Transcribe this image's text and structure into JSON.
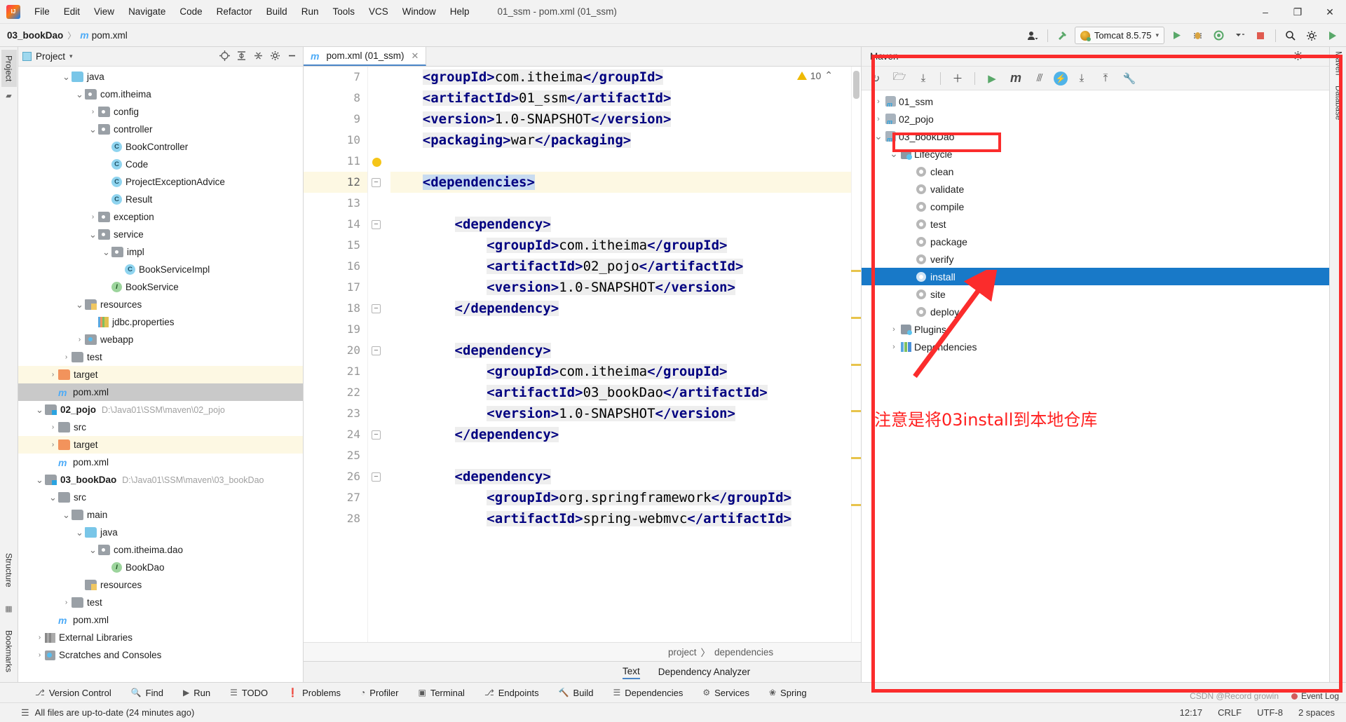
{
  "titlebar": {
    "menus": [
      "File",
      "Edit",
      "View",
      "Navigate",
      "Code",
      "Refactor",
      "Build",
      "Run",
      "Tools",
      "VCS",
      "Window",
      "Help"
    ],
    "window_title": "01_ssm - pom.xml (01_ssm)",
    "minimize": "–",
    "maximize": "❐",
    "close": "✕",
    "logo_name": "intellij-idea-logo"
  },
  "toolbar": {
    "breadcrumb_project": "03_bookDao",
    "breadcrumb_sep": "〉",
    "breadcrumb_file": "pom.xml",
    "m_glyph": "m",
    "run_config": "Tomcat 8.5.75",
    "run_config_caret": "▾",
    "icons": {
      "user": "♟",
      "hammer": "⚒",
      "run": "▶",
      "debug": "🐞",
      "coverage": "⬤",
      "more": "▾",
      "stop": "■",
      "search": "🔍",
      "settings": "⚙",
      "updates": "▶"
    }
  },
  "left_rail": {
    "project_tab": "Project",
    "structure_tab": "Structure",
    "bookmarks_tab": "Bookmarks"
  },
  "project_panel": {
    "title": "Project",
    "caret": "▾",
    "header_icons": [
      "locate-icon",
      "expand-all-icon",
      "collapse-all-icon",
      "settings-icon",
      "hide-icon"
    ],
    "tree": [
      {
        "indent": 3,
        "arrow": "v",
        "icon": "folder-blue",
        "label": "java"
      },
      {
        "indent": 4,
        "arrow": "v",
        "icon": "folder-pkg",
        "label": "com.itheima"
      },
      {
        "indent": 5,
        "arrow": ">",
        "icon": "folder-pkg",
        "label": "config"
      },
      {
        "indent": 5,
        "arrow": "v",
        "icon": "folder-pkg",
        "label": "controller"
      },
      {
        "indent": 6,
        "arrow": "",
        "icon": "class",
        "label": "BookController"
      },
      {
        "indent": 6,
        "arrow": "",
        "icon": "class",
        "label": "Code"
      },
      {
        "indent": 6,
        "arrow": "",
        "icon": "class",
        "label": "ProjectExceptionAdvice"
      },
      {
        "indent": 6,
        "arrow": "",
        "icon": "class",
        "label": "Result"
      },
      {
        "indent": 5,
        "arrow": ">",
        "icon": "folder-pkg",
        "label": "exception"
      },
      {
        "indent": 5,
        "arrow": "v",
        "icon": "folder-pkg",
        "label": "service"
      },
      {
        "indent": 6,
        "arrow": "v",
        "icon": "folder-pkg",
        "label": "impl"
      },
      {
        "indent": 7,
        "arrow": "",
        "icon": "class",
        "label": "BookServiceImpl"
      },
      {
        "indent": 6,
        "arrow": "",
        "icon": "interface",
        "label": "BookService"
      },
      {
        "indent": 4,
        "arrow": "v",
        "icon": "folder-res",
        "label": "resources"
      },
      {
        "indent": 5,
        "arrow": "",
        "icon": "properties",
        "label": "jdbc.properties"
      },
      {
        "indent": 4,
        "arrow": ">",
        "icon": "folder-web",
        "label": "webapp"
      },
      {
        "indent": 3,
        "arrow": ">",
        "icon": "folder-gray",
        "label": "test"
      },
      {
        "indent": 2,
        "arrow": ">",
        "icon": "folder-orange",
        "label": "target",
        "highlight": "yellow"
      },
      {
        "indent": 2,
        "arrow": "",
        "icon": "maven-file",
        "label": "pom.xml",
        "highlight": "gray"
      },
      {
        "indent": 1,
        "arrow": "v",
        "icon": "folder-module",
        "label": "02_pojo",
        "bold": true,
        "path": "D:\\Java01\\SSM\\maven\\02_pojo"
      },
      {
        "indent": 2,
        "arrow": ">",
        "icon": "folder-gray",
        "label": "src"
      },
      {
        "indent": 2,
        "arrow": ">",
        "icon": "folder-orange",
        "label": "target",
        "highlight": "yellow"
      },
      {
        "indent": 2,
        "arrow": "",
        "icon": "maven-file",
        "label": "pom.xml"
      },
      {
        "indent": 1,
        "arrow": "v",
        "icon": "folder-module",
        "label": "03_bookDao",
        "bold": true,
        "path": "D:\\Java01\\SSM\\maven\\03_bookDao"
      },
      {
        "indent": 2,
        "arrow": "v",
        "icon": "folder-gray",
        "label": "src"
      },
      {
        "indent": 3,
        "arrow": "v",
        "icon": "folder-gray",
        "label": "main"
      },
      {
        "indent": 4,
        "arrow": "v",
        "icon": "folder-blue",
        "label": "java"
      },
      {
        "indent": 5,
        "arrow": "v",
        "icon": "folder-pkg",
        "label": "com.itheima.dao"
      },
      {
        "indent": 6,
        "arrow": "",
        "icon": "interface",
        "label": "BookDao"
      },
      {
        "indent": 4,
        "arrow": "",
        "icon": "folder-res",
        "label": "resources"
      },
      {
        "indent": 3,
        "arrow": ">",
        "icon": "folder-gray",
        "label": "test"
      },
      {
        "indent": 2,
        "arrow": "",
        "icon": "maven-file",
        "label": "pom.xml"
      },
      {
        "indent": 1,
        "arrow": ">",
        "icon": "external-libs",
        "label": "External Libraries"
      },
      {
        "indent": 1,
        "arrow": ">",
        "icon": "scratches",
        "label": "Scratches and Consoles"
      }
    ]
  },
  "editor": {
    "tab_label": "pom.xml (01_ssm)",
    "tab_m_glyph": "m",
    "tab_close": "✕",
    "warning_count": "10",
    "warning_collapse": "⌃",
    "lines": [
      {
        "no": "7",
        "text": "    <groupId>com.itheima</groupId>"
      },
      {
        "no": "8",
        "text": "    <artifactId>01_ssm</artifactId>"
      },
      {
        "no": "9",
        "text": "    <version>1.0-SNAPSHOT</version>"
      },
      {
        "no": "10",
        "text": "    <packaging>war</packaging>"
      },
      {
        "no": "11",
        "text": ""
      },
      {
        "no": "12",
        "text": "    <dependencies>",
        "selected": true,
        "fold": true,
        "bulb": true
      },
      {
        "no": "13",
        "text": ""
      },
      {
        "no": "14",
        "text": "        <dependency>",
        "fold": true
      },
      {
        "no": "15",
        "text": "            <groupId>com.itheima</groupId>"
      },
      {
        "no": "16",
        "text": "            <artifactId>02_pojo</artifactId>"
      },
      {
        "no": "17",
        "text": "            <version>1.0-SNAPSHOT</version>"
      },
      {
        "no": "18",
        "text": "        </dependency>",
        "fold": true
      },
      {
        "no": "19",
        "text": ""
      },
      {
        "no": "20",
        "text": "        <dependency>",
        "fold": true
      },
      {
        "no": "21",
        "text": "            <groupId>com.itheima</groupId>"
      },
      {
        "no": "22",
        "text": "            <artifactId>03_bookDao</artifactId>"
      },
      {
        "no": "23",
        "text": "            <version>1.0-SNAPSHOT</version>"
      },
      {
        "no": "24",
        "text": "        </dependency>",
        "fold": true
      },
      {
        "no": "25",
        "text": ""
      },
      {
        "no": "26",
        "text": "        <dependency>",
        "fold": true
      },
      {
        "no": "27",
        "text": "            <groupId>org.springframework</groupId>"
      },
      {
        "no": "28",
        "text": "            <artifactId>spring-webmvc</artifactId>"
      }
    ],
    "breadcrumb": [
      "project",
      "dependencies"
    ],
    "breadcrumb_sep": "〉",
    "bottom_tabs": [
      {
        "label": "Text",
        "active": true
      },
      {
        "label": "Dependency Analyzer",
        "active": false
      }
    ]
  },
  "maven": {
    "title": "Maven",
    "header_icons": [
      "settings-icon",
      "minimize-icon"
    ],
    "toolbar_icons": [
      {
        "name": "reload-all-maven-projects-icon",
        "glyph": "↻"
      },
      {
        "name": "generate-sources-icon",
        "glyph": "🗁"
      },
      {
        "name": "download-sources-icon",
        "glyph": "⤓"
      },
      {
        "name": "add-maven-project-icon",
        "glyph": "＋"
      },
      {
        "name": "run-maven-build-icon",
        "glyph": "▶"
      },
      {
        "name": "execute-maven-goal-icon",
        "glyph": "m"
      },
      {
        "name": "toggle-skip-tests-icon",
        "glyph": "⫻"
      },
      {
        "name": "toggle-offline-mode-icon",
        "glyph": "⚡"
      },
      {
        "name": "expand-all-icon",
        "glyph": "⤓"
      },
      {
        "name": "collapse-all-icon",
        "glyph": "⤒"
      },
      {
        "name": "maven-settings-icon",
        "glyph": "🔧"
      }
    ],
    "tree": [
      {
        "indent": 0,
        "arrow": ">",
        "icon": "maven-module",
        "label": "01_ssm"
      },
      {
        "indent": 0,
        "arrow": ">",
        "icon": "maven-module",
        "label": "02_pojo"
      },
      {
        "indent": 0,
        "arrow": "v",
        "icon": "maven-module",
        "label": "03_bookDao",
        "boxed": true
      },
      {
        "indent": 1,
        "arrow": "v",
        "icon": "lifecycle",
        "label": "Lifecycle"
      },
      {
        "indent": 2,
        "arrow": "",
        "icon": "goal",
        "label": "clean"
      },
      {
        "indent": 2,
        "arrow": "",
        "icon": "goal",
        "label": "validate"
      },
      {
        "indent": 2,
        "arrow": "",
        "icon": "goal",
        "label": "compile"
      },
      {
        "indent": 2,
        "arrow": "",
        "icon": "goal",
        "label": "test"
      },
      {
        "indent": 2,
        "arrow": "",
        "icon": "goal",
        "label": "package"
      },
      {
        "indent": 2,
        "arrow": "",
        "icon": "goal",
        "label": "verify"
      },
      {
        "indent": 2,
        "arrow": "",
        "icon": "goal",
        "label": "install",
        "selected": true
      },
      {
        "indent": 2,
        "arrow": "",
        "icon": "goal",
        "label": "site"
      },
      {
        "indent": 2,
        "arrow": "",
        "icon": "goal",
        "label": "deploy"
      },
      {
        "indent": 1,
        "arrow": ">",
        "icon": "plugins",
        "label": "Plugins"
      },
      {
        "indent": 1,
        "arrow": ">",
        "icon": "dependencies",
        "label": "Dependencies"
      }
    ],
    "annotation_note": "注意是将03install到本地仓库",
    "annotation_color": "#ff2020",
    "rail_tabs": [
      "Maven",
      "Database"
    ]
  },
  "bottom_tabs": [
    {
      "label": "Version Control",
      "icon": "⎇"
    },
    {
      "label": "Find",
      "icon": "🔍"
    },
    {
      "label": "Run",
      "icon": "▶"
    },
    {
      "label": "TODO",
      "icon": "☰"
    },
    {
      "label": "Problems",
      "icon": "❗"
    },
    {
      "label": "Profiler",
      "icon": "◔"
    },
    {
      "label": "Terminal",
      "icon": "▣"
    },
    {
      "label": "Endpoints",
      "icon": "⎇"
    },
    {
      "label": "Build",
      "icon": "🔨"
    },
    {
      "label": "Dependencies",
      "icon": "☰"
    },
    {
      "label": "Services",
      "icon": "⚙"
    },
    {
      "label": "Spring",
      "icon": "❀"
    }
  ],
  "statusbar": {
    "icon": "☰",
    "message": "All files are up-to-date (24 minutes ago)",
    "time": "12:17",
    "line_ending": "CRLF",
    "encoding": "UTF-8",
    "indent": "2 spaces",
    "event_log": "Event Log",
    "watermark": "CSDN @Record growin"
  }
}
